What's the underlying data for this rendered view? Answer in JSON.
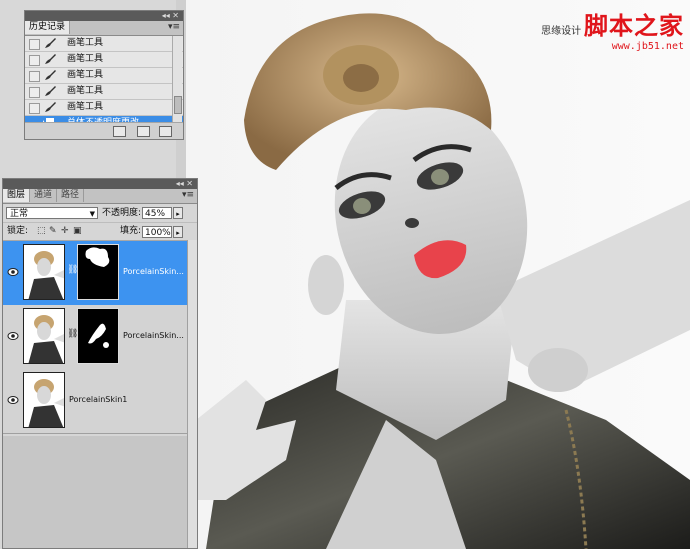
{
  "watermark": {
    "line1": "思缘设计",
    "brand": "脚本之家",
    "url": "www.jb51.net"
  },
  "history_panel": {
    "tab": "历史记录",
    "items": [
      {
        "label": "画笔工具",
        "selected": false
      },
      {
        "label": "画笔工具",
        "selected": false
      },
      {
        "label": "画笔工具",
        "selected": false
      },
      {
        "label": "画笔工具",
        "selected": false
      },
      {
        "label": "画笔工具",
        "selected": false
      },
      {
        "label": "总体不透明度更改",
        "selected": true
      }
    ]
  },
  "layers_panel": {
    "tabs": [
      "图层",
      "通道",
      "路径"
    ],
    "active_tab": "图层",
    "blend_mode": "正常",
    "opacity_label": "不透明度:",
    "opacity_value": "45%",
    "lock_label": "锁定:",
    "fill_label": "填充:",
    "fill_value": "100%",
    "layers": [
      {
        "name": "PorcelainSkin...",
        "selected": true,
        "has_mask": true
      },
      {
        "name": "PorcelainSkin...",
        "selected": false,
        "has_mask": true
      },
      {
        "name": "PorcelainSkin1",
        "selected": false,
        "has_mask": false
      }
    ]
  },
  "colors": {
    "selection_blue": "#3d93f0",
    "panel_gray": "#d6d6d6",
    "brand_red": "#e0151b"
  }
}
